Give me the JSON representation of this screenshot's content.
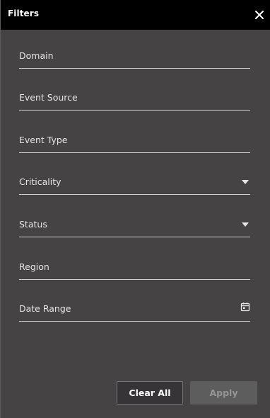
{
  "header": {
    "title": "Filters",
    "close_icon": "close-icon"
  },
  "fields": {
    "domain": {
      "label": "Domain"
    },
    "event_source": {
      "label": "Event Source"
    },
    "event_type": {
      "label": "Event Type"
    },
    "criticality": {
      "label": "Criticality",
      "icon": "caret-down-icon"
    },
    "status": {
      "label": "Status",
      "icon": "caret-down-icon"
    },
    "region": {
      "label": "Region"
    },
    "date_range": {
      "label": "Date Range",
      "icon": "calendar-icon"
    }
  },
  "actions": {
    "clear_label": "Clear All",
    "apply_label": "Apply"
  },
  "colors": {
    "header_bg": "#000000",
    "panel_bg": "#464345",
    "text": "#e6e6e6",
    "underline": "#cfcfcf",
    "apply_disabled_bg": "#5e5d5e",
    "clear_bg": "#363436"
  }
}
